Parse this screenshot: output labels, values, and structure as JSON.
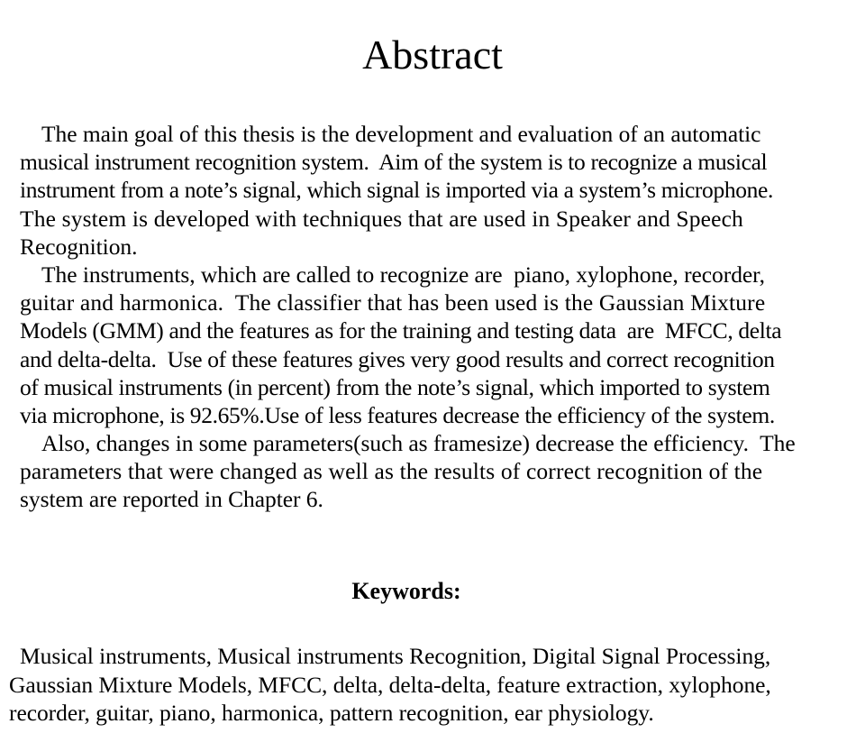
{
  "document": {
    "title": "Abstract",
    "abstract_lines": [
      {
        "text": "The main goal of this thesis is the development and evaluation of an automatic",
        "indent": true,
        "tracking": "normal"
      },
      {
        "text": "musical instrument recognition system.  Aim of the system is to recognize a musical",
        "indent": false,
        "tracking": "tight"
      },
      {
        "text": "instrument from a note’s signal, which signal is imported via a system’s microphone.",
        "indent": false,
        "tracking": "tight"
      },
      {
        "text": "The system is developed with techniques that are used in Speaker and Speech",
        "indent": false,
        "tracking": "loose"
      },
      {
        "text": "Recognition.",
        "indent": false,
        "tracking": "normal"
      },
      {
        "text": "The instruments, which are called to recognize are  piano, xylophone, recorder,",
        "indent": true,
        "tracking": "normal"
      },
      {
        "text": "guitar and harmonica.  The classifier that has been used is the Gaussian Mixture",
        "indent": false,
        "tracking": "loose"
      },
      {
        "text": "Models (GMM) and the features as for the training and testing data  are  MFCC, delta",
        "indent": false,
        "tracking": "tight"
      },
      {
        "text": "and delta-delta.  Use of these features gives very good results and correct recognition",
        "indent": false,
        "tracking": "tight"
      },
      {
        "text": "of musical instruments (in percent) from the note’s signal, which imported to system",
        "indent": false,
        "tracking": "tight"
      },
      {
        "text": "via microphone, is 92.65%.Use of less features decrease the efficiency of the system.",
        "indent": false,
        "tracking": "tight"
      },
      {
        "text": "Also, changes in some parameters(such as framesize) decrease the efficiency.  The",
        "indent": true,
        "tracking": "normal"
      },
      {
        "text": "parameters that were changed as well as the results of correct recognition of the",
        "indent": false,
        "tracking": "loose"
      },
      {
        "text": "system are reported in Chapter 6.",
        "indent": false,
        "tracking": "normal"
      }
    ],
    "abstract_text": "The main goal of this thesis is the development and evaluation of an automatic musical instrument recognition system. Aim of the system is to recognize a musical instrument from a note’s signal, which signal is imported via a system’s microphone. The system is developed with techniques that are used in Speaker and Speech Recognition. The instruments, which are called to recognize are piano, xylophone, recorder, guitar and harmonica. The classifier that has been used is the Gaussian Mixture Models (GMM) and the features as for the training and testing data are MFCC, delta and delta-delta. Use of these features gives very good results and correct recognition of musical instruments (in percent) from the note’s signal, which imported to system via microphone, is 92.65%.Use of less features decrease the efficiency of the system. Also, changes in some parameters(such as framesize) decrease the efficiency. The parameters that were changed as well as the results of correct recognition of the system are reported in Chapter 6.",
    "keywords_heading": "Keywords:",
    "keywords_lines": [
      {
        "text": "Musical instruments, Musical instruments Recognition, Digital Signal Processing,",
        "indent": true
      },
      {
        "text": "Gaussian Mixture Models, MFCC, delta, delta-delta, feature extraction, xylophone,",
        "indent": false
      },
      {
        "text": "recorder, guitar, piano, harmonica, pattern recognition, ear physiology.",
        "indent": false
      }
    ],
    "keywords_text": "Musical instruments, Musical instruments Recognition, Digital Signal Processing, Gaussian Mixture Models, MFCC, delta, delta-delta, feature extraction, xylophone, recorder, guitar, piano, harmonica, pattern recognition, ear physiology.",
    "reported_accuracy": "92.65%",
    "chapter_reference": "Chapter 6",
    "colors": {
      "page_background": "#ffffff",
      "text": "#000000"
    }
  }
}
